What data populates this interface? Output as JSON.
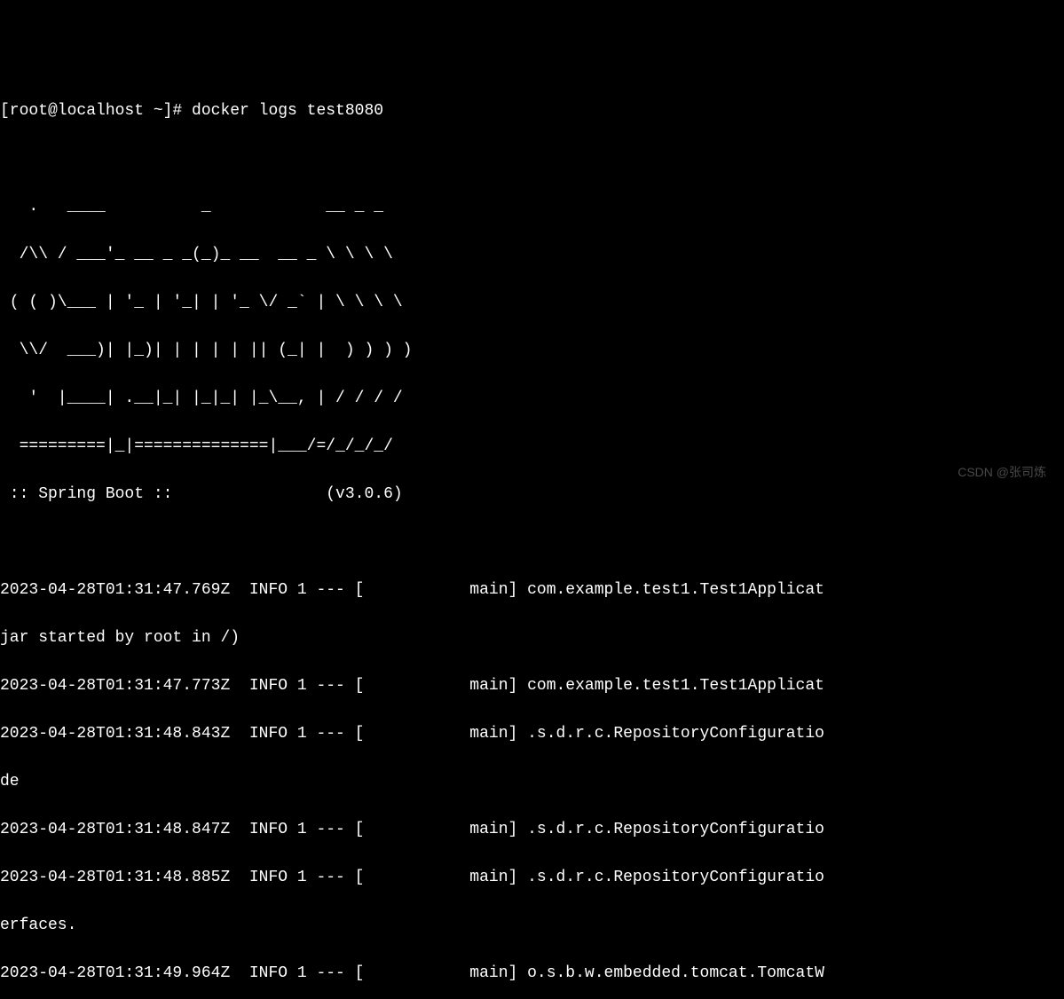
{
  "prompt": "[root@localhost ~]# docker logs test8080",
  "banner": {
    "line1": "   .   ____          _            __ _ _",
    "line2": "  /\\\\ / ___'_ __ _ _(_)_ __  __ _ \\ \\ \\ \\",
    "line3": " ( ( )\\___ | '_ | '_| | '_ \\/ _` | \\ \\ \\ \\",
    "line4": "  \\\\/  ___)| |_)| | | | | || (_| |  ) ) ) )",
    "line5": "   '  |____| .__|_| |_|_| |_\\__, | / / / /",
    "line6": "  =========|_|==============|___/=/_/_/_/",
    "title": " :: Spring Boot ::                (v3.0.6)"
  },
  "logs": {
    "line1": "2023-04-28T01:31:47.769Z  INFO 1 --- [           main] com.example.test1.Test1Applicat",
    "line2": "jar started by root in /)",
    "line3": "2023-04-28T01:31:47.773Z  INFO 1 --- [           main] com.example.test1.Test1Applicat",
    "line4": "2023-04-28T01:31:48.843Z  INFO 1 --- [           main] .s.d.r.c.RepositoryConfiguratio",
    "line5": "de",
    "line6": "2023-04-28T01:31:48.847Z  INFO 1 --- [           main] .s.d.r.c.RepositoryConfiguratio",
    "line7": "2023-04-28T01:31:48.885Z  INFO 1 --- [           main] .s.d.r.c.RepositoryConfiguratio",
    "line8": "erfaces.",
    "line9": "2023-04-28T01:31:49.964Z  INFO 1 --- [           main] o.s.b.w.embedded.tomcat.TomcatW"
  },
  "watermark": "CSDN @张司炼"
}
